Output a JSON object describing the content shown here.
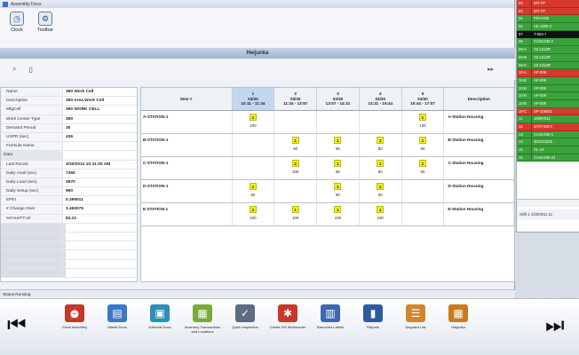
{
  "window": {
    "title": "Assembly Docs"
  },
  "toolbar": [
    {
      "label": "Clock",
      "icon": "clock-icon",
      "glyph": "◷"
    },
    {
      "label": "Toolbar",
      "icon": "toolbar-icon",
      "glyph": "⚙"
    }
  ],
  "header": {
    "title": "Heijunka"
  },
  "subbar": {
    "right_glyph": "▸▸"
  },
  "properties": [
    {
      "key": "Name",
      "value": "390 Work Cell"
    },
    {
      "key": "Description",
      "value": "390 Area Work Cell"
    },
    {
      "key": "MfgCell",
      "value": "390 WORK CELL"
    },
    {
      "key": "Work Center Type",
      "value": "390"
    },
    {
      "key": "Demand Period",
      "value": "30"
    },
    {
      "key": "USPR (sec)",
      "value": "436"
    },
    {
      "key": "Formula Name",
      "value": ""
    },
    {
      "key": "Data",
      "value": "",
      "section": true
    },
    {
      "key": "Last Recalc",
      "value": "3/30/2012 10:11:00 AM"
    },
    {
      "key": "Daily Avail (sec)",
      "value": "7360"
    },
    {
      "key": "Daily Load (sec)",
      "value": "3870"
    },
    {
      "key": "Daily Setup (sec)",
      "value": "960"
    },
    {
      "key": "EPEI",
      "value": "0.399011"
    },
    {
      "key": "# Change Over",
      "value": "3.460075"
    },
    {
      "key": "%Free/FTU/r",
      "value": "83.22"
    },
    {
      "key": "",
      "value": "",
      "dark": true
    },
    {
      "key": "",
      "value": "",
      "dark": true
    },
    {
      "key": "",
      "value": "",
      "dark": true
    },
    {
      "key": "",
      "value": "",
      "dark": true
    },
    {
      "key": "",
      "value": "",
      "dark": true
    },
    {
      "key": "",
      "value": "",
      "dark": true
    }
  ],
  "grid": {
    "item_header": "Item #",
    "desc_header": "Description",
    "slots": [
      {
        "num": "1",
        "date": "03/30",
        "time": "10:11 - 11:34"
      },
      {
        "num": "2",
        "date": "03/30",
        "time": "11:34 - 13:57"
      },
      {
        "num": "3",
        "date": "03/30",
        "time": "13:57 - 14:31"
      },
      {
        "num": "4",
        "date": "03/30",
        "time": "14:31 - 15:44"
      },
      {
        "num": "5",
        "date": "03/30",
        "time": "15:44 - 17:07"
      }
    ],
    "rows": [
      {
        "item": "A-STATION-1",
        "desc": "A-Station Housing",
        "cells": [
          {
            "q": "1",
            "v": "100"
          },
          null,
          null,
          null,
          {
            "q": "1",
            "v": "100"
          }
        ]
      },
      {
        "item": "B-STATION-1",
        "desc": "B-Station Housing",
        "cells": [
          null,
          {
            "q": "1",
            "v": "50"
          },
          {
            "q": "1",
            "v": "50"
          },
          {
            "q": "1",
            "v": "50"
          },
          {
            "q": "1",
            "v": "50"
          }
        ]
      },
      {
        "item": "C-STATION-1",
        "desc": "C-Station Housing",
        "cells": [
          null,
          {
            "q": "2",
            "v": "100"
          },
          {
            "q": "1",
            "v": "50"
          },
          {
            "q": "1",
            "v": "50"
          },
          {
            "q": "1",
            "v": "50"
          }
        ]
      },
      {
        "item": "D-STATION-1",
        "desc": "D-Station Housing",
        "cells": [
          {
            "q": "1",
            "v": "50"
          },
          null,
          {
            "q": "1",
            "v": "50"
          },
          {
            "q": "1",
            "v": "50"
          },
          null
        ]
      },
      {
        "item": "E-STATION-1",
        "desc": "E-Station Housing",
        "cells": [
          {
            "q": "1",
            "v": "100"
          },
          {
            "q": "1",
            "v": "100"
          },
          {
            "q": "1",
            "v": "100"
          },
          {
            "q": "1",
            "v": "100"
          },
          null
        ]
      }
    ]
  },
  "status": {
    "text": "Status Running"
  },
  "nav": {
    "items": [
      {
        "label": "Clock Assembly",
        "icon": "clock-assembly-icon",
        "color": "#c0392b",
        "glyph": "⏰"
      },
      {
        "label": "Mtrmtl Docs",
        "icon": "document-icon",
        "color": "#3a78c8",
        "glyph": "▤"
      },
      {
        "label": "External Docs",
        "icon": "external-docs-icon",
        "color": "#2f8fb5",
        "glyph": "▣"
      },
      {
        "label": "Inventory Transactions and Locations",
        "icon": "inventory-icon",
        "color": "#7aa83a",
        "glyph": "▦"
      },
      {
        "label": "Quick Inspection",
        "icon": "chart-icon",
        "color": "#5d6c80",
        "glyph": "✓"
      },
      {
        "label": "Create FM Worksorder",
        "icon": "gift-icon",
        "color": "#c8382a",
        "glyph": "✱"
      },
      {
        "label": "Barcoded Labels",
        "icon": "labels-icon",
        "color": "#3f67b0",
        "glyph": "▥"
      },
      {
        "label": "Reports",
        "icon": "reports-icon",
        "color": "#2c5aa0",
        "glyph": "▮"
      },
      {
        "label": "Dispatch List",
        "icon": "dispatch-icon",
        "color": "#d0872a",
        "glyph": "☰"
      },
      {
        "label": "Heijunka",
        "icon": "heijunka-icon",
        "color": "#c77b1f",
        "glyph": "▦"
      }
    ]
  },
  "right_panel": {
    "rows": [
      {
        "c1": "04",
        "c2": "BIT-TP",
        "bg": "#d63a2f"
      },
      {
        "c1": "04",
        "c2": "BIT-TP",
        "bg": "#d63a2f"
      },
      {
        "c1": "05",
        "c2": "PDH-005",
        "bg": "#3aa23a"
      },
      {
        "c1": "06",
        "c2": "AE-1300-C",
        "bg": "#3aa23a"
      },
      {
        "c1": "07",
        "c2": "T-004-7",
        "bg": "#111111"
      },
      {
        "c1": "08",
        "c2": "CASCOM-2",
        "bg": "#3aa23a"
      },
      {
        "c1": "09-A",
        "c2": "S2-1313R",
        "bg": "#3aa23a"
      },
      {
        "c1": "09-B",
        "c2": "S2-1313R",
        "bg": "#3aa23a"
      },
      {
        "c1": "09-C",
        "c2": "S2-1313R",
        "bg": "#3aa23a"
      },
      {
        "c1": "10-A",
        "c2": "AP-009",
        "bg": "#d63a2f"
      },
      {
        "c1": "10-B",
        "c2": "AP-009",
        "bg": "#3aa23a"
      },
      {
        "c1": "10-B",
        "c2": "AP-009",
        "bg": "#3aa23a"
      },
      {
        "c1": "10-B",
        "c2": "AP-009",
        "bg": "#3aa23a"
      },
      {
        "c1": "10-B",
        "c2": "AP-009",
        "bg": "#3aa23a"
      },
      {
        "c1": "10-C",
        "c2": "SP-105001",
        "bg": "#d63a2f"
      },
      {
        "c1": "11",
        "c2": "10087014",
        "bg": "#3aa23a"
      },
      {
        "c1": "12",
        "c2": "STAT-837A",
        "bg": "#d63a2f"
      },
      {
        "c1": "13",
        "c2": "CASCOM-1",
        "bg": "#3aa23a"
      },
      {
        "c1": "14",
        "c2": "301013226",
        "bg": "#3aa23a"
      },
      {
        "c1": "15",
        "c2": "CL-14",
        "bg": "#3aa23a"
      },
      {
        "c1": "16",
        "c2": "CASCOM-24",
        "bg": "#3aa23a"
      }
    ],
    "footer": "Shift 1  4/28/2011 11:"
  }
}
